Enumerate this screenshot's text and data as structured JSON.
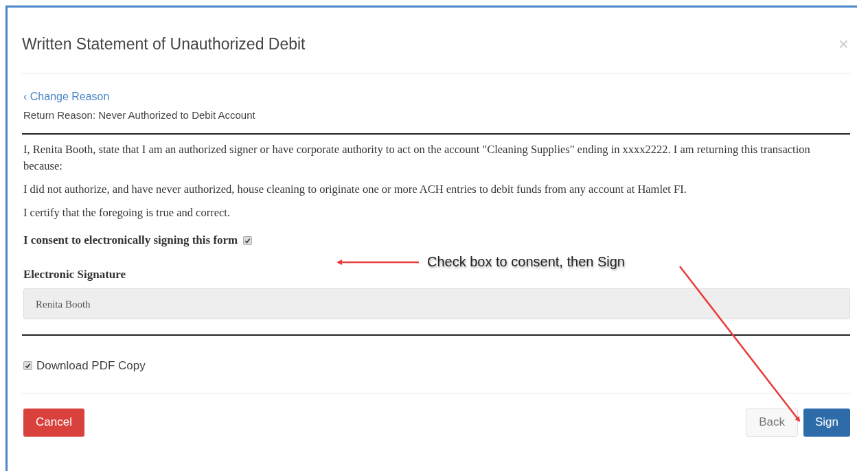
{
  "dialog": {
    "title": "Written Statement of Unauthorized Debit",
    "close": "×"
  },
  "back_link": "‹ Change Reason",
  "return_reason": "Return Reason: Never Authorized to Debit Account",
  "statement": [
    "I, Renita Booth, state that I am an authorized signer or have corporate authority to act on the account \"Cleaning Supplies\" ending in xxxx2222. I am returning this transaction because:",
    "I did not authorize, and have never authorized, house cleaning to originate one or more ACH entries to debit funds from any account at Hamlet FI.",
    "I certify that the foregoing is true and correct."
  ],
  "consent": {
    "label": "I consent to electronically signing this form",
    "checked": true
  },
  "signature": {
    "label": "Electronic Signature",
    "value": "Renita Booth"
  },
  "download_pdf": {
    "label": "Download PDF Copy",
    "checked": true
  },
  "buttons": {
    "cancel": "Cancel",
    "back": "Back",
    "sign": "Sign"
  },
  "annotation": "Check box to consent, then Sign"
}
